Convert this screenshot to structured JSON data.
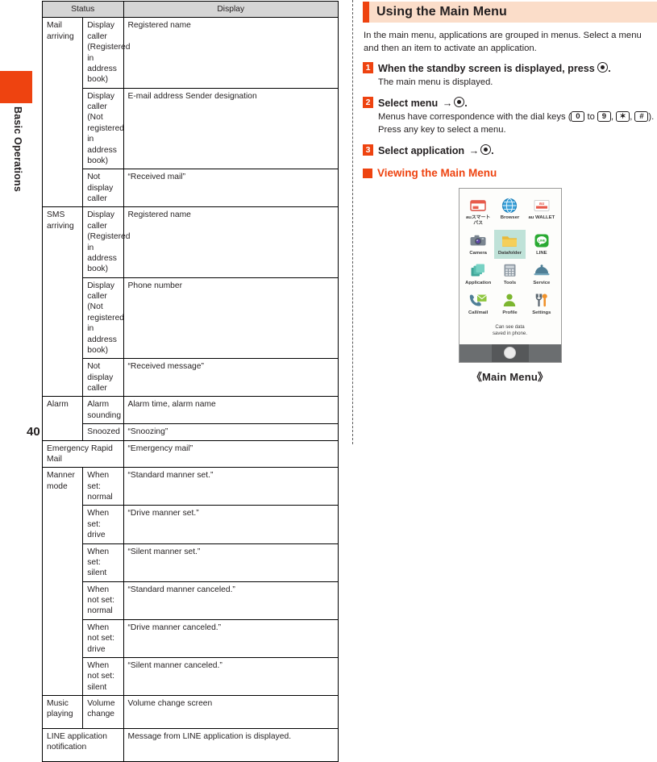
{
  "chapter": {
    "label": "Basic Operations",
    "accent_color": "#ee4310"
  },
  "page_number": "40",
  "table": {
    "headers": [
      "Status",
      "Display"
    ],
    "rows": [
      {
        "group": "Mail arriving",
        "condition": "Display caller\n(Registered in address book)",
        "display": "Registered name"
      },
      {
        "group": "",
        "condition": "Display caller\n(Not registered in address book)",
        "display": "E-mail address\nSender designation"
      },
      {
        "group": "",
        "condition": "Not display caller",
        "display": "“Received mail”"
      },
      {
        "group": "SMS arriving",
        "condition": "Display caller\n(Registered in address book)",
        "display": "Registered name"
      },
      {
        "group": "",
        "condition": "Display caller\n(Not registered in address book)",
        "display": "Phone number"
      },
      {
        "group": "",
        "condition": "Not display caller",
        "display": "“Received message”"
      },
      {
        "group": "Alarm",
        "condition": "Alarm sounding",
        "display": "Alarm time, alarm name"
      },
      {
        "group": "",
        "condition": "Snoozed",
        "display": "“Snoozing”"
      },
      {
        "group": "Emergency Rapid Mail",
        "condition": "",
        "display": "“Emergency mail”"
      },
      {
        "group": "Manner mode",
        "condition": "When set: normal",
        "display": "“Standard manner set.”"
      },
      {
        "group": "",
        "condition": "When set: drive",
        "display": "“Drive manner set.”"
      },
      {
        "group": "",
        "condition": "When set: silent",
        "display": "“Silent manner set.”"
      },
      {
        "group": "",
        "condition": "When not set: normal",
        "display": "“Standard manner canceled.”"
      },
      {
        "group": "",
        "condition": "When not set: drive",
        "display": "“Drive manner canceled.”"
      },
      {
        "group": "",
        "condition": "When not set: silent",
        "display": "“Silent manner canceled.”"
      },
      {
        "group": "Music playing",
        "condition": "Volume change",
        "display": "Volume change screen"
      },
      {
        "group": "LINE application notification",
        "condition": "",
        "display": "Message from LINE application is displayed."
      }
    ],
    "cells": {
      "c_mail_group": "Mail arriving",
      "c_mail_1_cond": "Display caller (Registered in address book)",
      "c_mail_1_disp": "Registered name",
      "c_mail_2_cond": "Display caller (Not registered in address book)",
      "c_mail_2_disp": "E-mail address Sender designation",
      "c_mail_3_cond": "Not display caller",
      "c_mail_3_disp": "“Received mail”",
      "c_sms_group": "SMS arriving",
      "c_sms_1_cond": "Display caller (Registered in address book)",
      "c_sms_1_disp": "Registered name",
      "c_sms_2_cond": "Display caller (Not registered in address book)",
      "c_sms_2_disp": "Phone number",
      "c_sms_3_cond": "Not display caller",
      "c_sms_3_disp": "“Received message”",
      "c_alarm_group": "Alarm",
      "c_alarm_1_cond": "Alarm sounding",
      "c_alarm_1_disp": "Alarm time, alarm name",
      "c_alarm_2_cond": "Snoozed",
      "c_alarm_2_disp": "“Snoozing”",
      "c_erm_label": "Emergency Rapid Mail",
      "c_erm_disp": "“Emergency mail”",
      "c_manner_group": "Manner mode",
      "c_manner_1_cond": "When set: normal",
      "c_manner_1_disp": "“Standard manner set.”",
      "c_manner_2_cond": "When set: drive",
      "c_manner_2_disp": "“Drive manner set.”",
      "c_manner_3_cond": "When set: silent",
      "c_manner_3_disp": "“Silent manner set.”",
      "c_manner_4_cond": "When not set: normal",
      "c_manner_4_disp": "“Standard manner canceled.”",
      "c_manner_5_cond": "When not set: drive",
      "c_manner_5_disp": "“Drive manner canceled.”",
      "c_manner_6_cond": "When not set: silent",
      "c_manner_6_disp": "“Silent manner canceled.”",
      "c_music_group": "Music playing",
      "c_music_1_cond": "Volume change",
      "c_music_1_disp": "Volume change screen",
      "c_line_label": "LINE application notification",
      "c_line_disp": "Message from LINE application is displayed."
    }
  },
  "section": {
    "title": "Using the Main Menu",
    "intro": "In the main menu, applications are grouped in menus. Select a menu and then an item to activate an application.",
    "steps": [
      {
        "number": "1",
        "head_before": "When the standby screen is displayed, press ",
        "head_after": ".",
        "body": "The main menu is displayed."
      },
      {
        "number": "2",
        "head_before": "Select menu ",
        "head_after": ".",
        "body_p1": "Menus have correspondence with the dial keys (",
        "key_first": "0",
        "body_to": " to ",
        "key_last": "9",
        "body_comma": ", ",
        "key_star": "✶",
        "body_comma2": ", ",
        "key_hash": "#",
        "body_p2": "). Press any key to select a menu."
      },
      {
        "number": "3",
        "head_before": "Select application ",
        "head_after": "."
      }
    ],
    "subheading": "Viewing the Main Menu"
  },
  "phone": {
    "caption": "《Main Menu》",
    "hint_line1": "Can see data",
    "hint_line2": "saved in phone.",
    "icons": [
      {
        "label": "auスマート\nパス",
        "icon_name": "au-smart-pass-icon",
        "selected": false
      },
      {
        "label": "Browser",
        "icon_name": "globe-icon",
        "selected": false
      },
      {
        "label": "au WALLET",
        "icon_name": "au-wallet-icon",
        "selected": false
      },
      {
        "label": "Camera",
        "icon_name": "camera-icon",
        "selected": false
      },
      {
        "label": "Datafolder",
        "icon_name": "folder-icon",
        "selected": true
      },
      {
        "label": "LINE",
        "icon_name": "line-icon",
        "selected": false
      },
      {
        "label": "Application",
        "icon_name": "stacked-squares-icon",
        "selected": false
      },
      {
        "label": "Tools",
        "icon_name": "calculator-icon",
        "selected": false
      },
      {
        "label": "Service",
        "icon_name": "bell-icon",
        "selected": false
      },
      {
        "label": "Call/mail",
        "icon_name": "phone-mail-icon",
        "selected": false
      },
      {
        "label": "Profile",
        "icon_name": "person-icon",
        "selected": false
      },
      {
        "label": "Settings",
        "icon_name": "tools-wrench-icon",
        "selected": false
      }
    ],
    "icon_labels": {
      "l0a": "auスマート",
      "l0b": "パス",
      "l1": "Browser",
      "l2": "au WALLET",
      "l3": "Camera",
      "l4": "Datafolder",
      "l5": "LINE",
      "l6": "Application",
      "l7": "Tools",
      "l8": "Service",
      "l9": "Call/mail",
      "l10": "Profile",
      "l11": "Settings"
    }
  }
}
